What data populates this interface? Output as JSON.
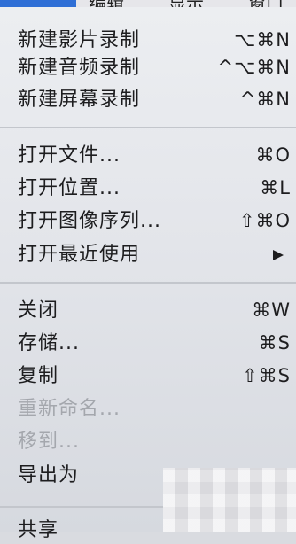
{
  "menubar": {
    "items": [
      "",
      "编辑",
      "显示",
      "窗口"
    ]
  },
  "menu": {
    "groups": [
      {
        "items": [
          {
            "label": "新建影片录制",
            "shortcut": "⌥⌘N",
            "enabled": true
          },
          {
            "label": "新建音频录制",
            "shortcut": "^⌥⌘N",
            "enabled": true
          },
          {
            "label": "新建屏幕录制",
            "shortcut": "^⌘N",
            "enabled": true
          }
        ]
      },
      {
        "items": [
          {
            "label": "打开文件...",
            "shortcut": "⌘O",
            "enabled": true
          },
          {
            "label": "打开位置...",
            "shortcut": "⌘L",
            "enabled": true
          },
          {
            "label": "打开图像序列...",
            "shortcut": "⇧⌘O",
            "enabled": true
          },
          {
            "label": "打开最近使用",
            "shortcut": "",
            "enabled": true,
            "submenu": true
          }
        ]
      },
      {
        "items": [
          {
            "label": "关闭",
            "shortcut": "⌘W",
            "enabled": true
          },
          {
            "label": "存储...",
            "shortcut": "⌘S",
            "enabled": true
          },
          {
            "label": "复制",
            "shortcut": "⇧⌘S",
            "enabled": true
          },
          {
            "label": "重新命名...",
            "shortcut": "",
            "enabled": false
          },
          {
            "label": "移到...",
            "shortcut": "",
            "enabled": false
          },
          {
            "label": "导出为",
            "shortcut": "",
            "enabled": true
          }
        ]
      },
      {
        "items": [
          {
            "label": "共享",
            "shortcut": "",
            "enabled": true
          }
        ]
      }
    ]
  }
}
